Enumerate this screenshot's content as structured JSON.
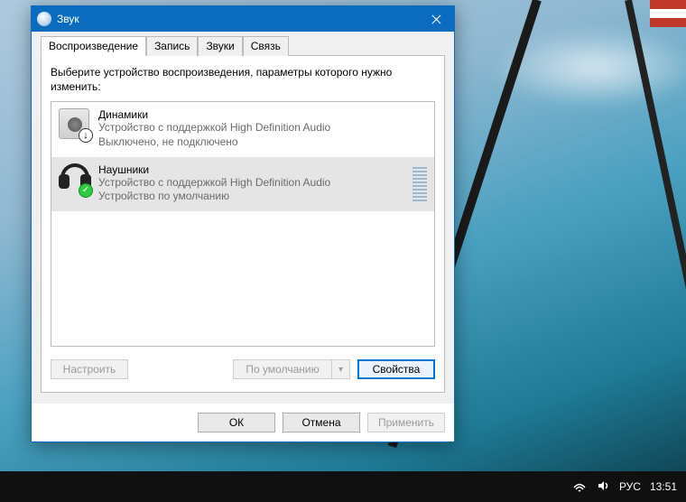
{
  "window": {
    "title": "Звук",
    "instruction": "Выберите устройство воспроизведения, параметры которого нужно изменить:"
  },
  "tabs": [
    {
      "label": "Воспроизведение",
      "active": true
    },
    {
      "label": "Запись",
      "active": false
    },
    {
      "label": "Звуки",
      "active": false
    },
    {
      "label": "Связь",
      "active": false
    }
  ],
  "devices": [
    {
      "name": "Динамики",
      "desc": "Устройство с поддержкой High Definition Audio",
      "status": "Выключено, не подключено",
      "selected": false,
      "icon": "speaker",
      "badge": "disabled"
    },
    {
      "name": "Наушники",
      "desc": "Устройство с поддержкой High Definition Audio",
      "status": "Устройство по умолчанию",
      "selected": true,
      "icon": "headphones",
      "badge": "default"
    }
  ],
  "buttons": {
    "configure": "Настроить",
    "set_default": "По умолчанию",
    "properties": "Свойства",
    "ok": "ОК",
    "cancel": "Отмена",
    "apply": "Применить"
  },
  "taskbar": {
    "lang": "РУС",
    "time": "13:51"
  }
}
